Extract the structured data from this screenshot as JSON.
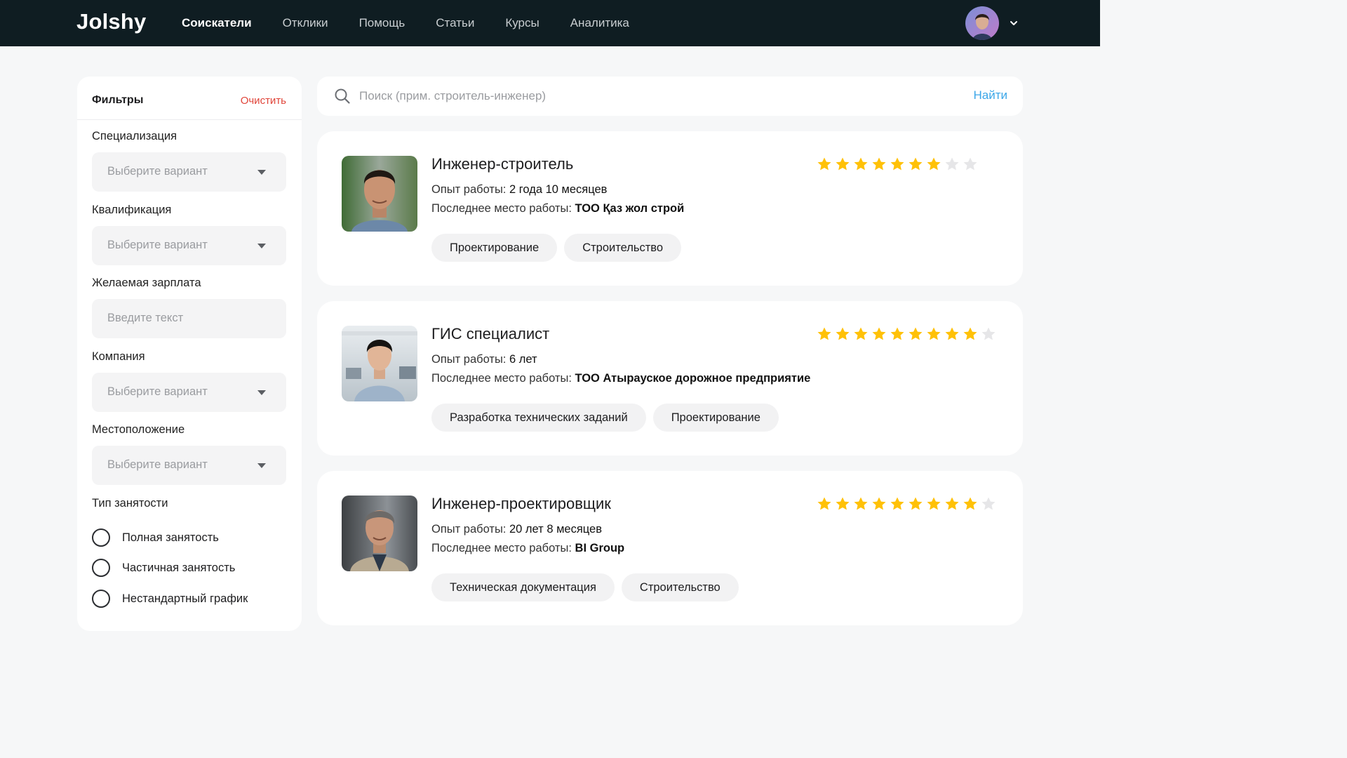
{
  "brand": {
    "logo": "Jolshy"
  },
  "nav": {
    "items": [
      {
        "label": "Соискатели",
        "active": true
      },
      {
        "label": "Отклики",
        "active": false
      },
      {
        "label": "Помощь",
        "active": false
      },
      {
        "label": "Статьи",
        "active": false
      },
      {
        "label": "Курсы",
        "active": false
      },
      {
        "label": "Аналитика",
        "active": false
      }
    ]
  },
  "filters": {
    "title": "Фильтры",
    "clear_label": "Очистить",
    "specialization": {
      "label": "Специализация",
      "placeholder": "Выберите вариант"
    },
    "qualification": {
      "label": "Квалификация",
      "placeholder": "Выберите вариант"
    },
    "salary": {
      "label": "Желаемая зарплата",
      "placeholder": "Введите текст"
    },
    "company": {
      "label": "Компания",
      "placeholder": "Выберите вариант"
    },
    "location": {
      "label": "Местоположение",
      "placeholder": "Выберите вариант"
    },
    "employment": {
      "label": "Тип занятости",
      "options": [
        "Полная занятость",
        "Частичная занятость",
        "Нестандартный график"
      ]
    }
  },
  "search": {
    "placeholder": "Поиск (прим. строитель-инженер)",
    "button_label": "Найти"
  },
  "candidates": [
    {
      "title": "Инженер-строитель",
      "experience_label": "Опыт работы:",
      "experience": "2 года 10 месяцев",
      "last_job_label": "Последнее место работы:",
      "last_job": "ТОО Қаз жол строй",
      "rating": 7,
      "rating_max": 9,
      "tags": [
        "Проектирование",
        "Строительство"
      ]
    },
    {
      "title": "ГИС специалист",
      "experience_label": "Опыт работы:",
      "experience": "6 лет",
      "last_job_label": "Последнее место работы:",
      "last_job": "ТОО Атырауское дорожное предприятие",
      "rating": 9,
      "rating_max": 10,
      "tags": [
        "Разработка технических заданий",
        "Проектирование"
      ]
    },
    {
      "title": "Инженер-проектировщик",
      "experience_label": "Опыт работы:",
      "experience": "20 лет 8 месяцев",
      "last_job_label": "Последнее место работы:",
      "last_job": "BI Group",
      "rating": 9,
      "rating_max": 10,
      "tags": [
        "Техническая документация",
        "Строительство"
      ]
    }
  ],
  "colors": {
    "topbar": "#0f1d22",
    "accent_link": "#3aa6e8",
    "clear_red": "#e0453a",
    "star_filled": "#ffc107",
    "star_empty": "#e6e6e8"
  }
}
